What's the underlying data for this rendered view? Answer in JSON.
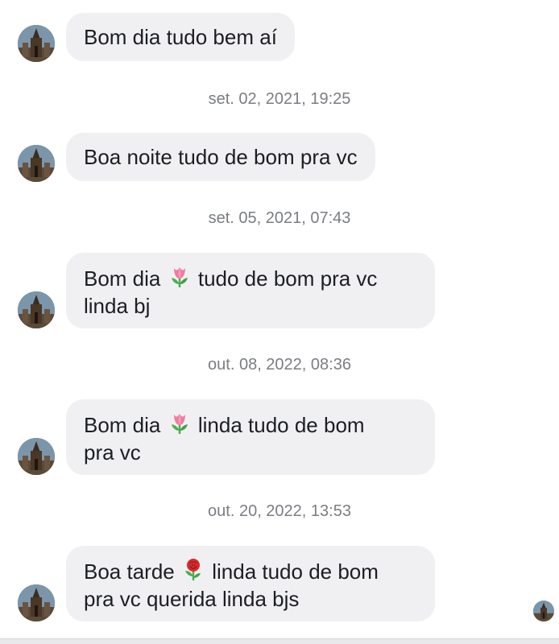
{
  "messages": [
    {
      "text": "Bom dia tudo bem aí"
    },
    {
      "text": "Boa noite tudo de bom pra vc"
    },
    {
      "line1_a": "Bom dia",
      "line1_b": "tudo de bom pra vc",
      "line2": "linda bj",
      "emoji": "tulip"
    },
    {
      "line1_a": "Bom dia",
      "line1_b": "linda tudo de bom",
      "line2": "pra vc",
      "emoji": "tulip"
    },
    {
      "line1_a": "Boa tarde",
      "line1_b": "linda tudo de bom",
      "line2": "pra vc querida linda bjs",
      "emoji": "rose"
    }
  ],
  "timestamps": [
    "set. 02, 2021, 19:25",
    "set. 05, 2021, 07:43",
    "out. 08, 2022, 08:36",
    "out. 20, 2022, 13:53"
  ],
  "colors": {
    "bubble": "#f0f0f3",
    "text": "#1c1e21",
    "timestamp": "#7a7d82",
    "tulip": "#f17aa0",
    "rose": "#d92b2b",
    "leaf": "#4caf50"
  }
}
